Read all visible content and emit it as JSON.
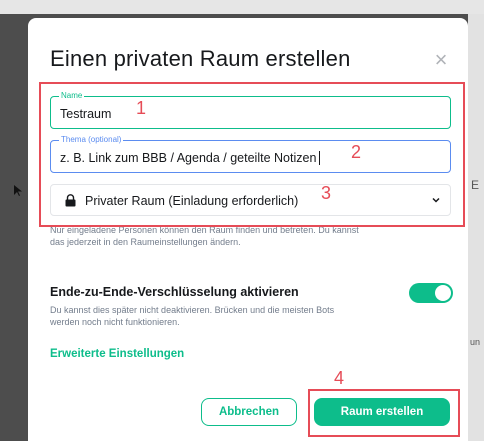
{
  "background": {
    "right_hint": "E",
    "right_hint2": "un"
  },
  "dialog": {
    "title": "Einen privaten Raum erstellen",
    "close_icon": "close-icon",
    "name_field": {
      "label": "Name",
      "value": "Testraum"
    },
    "topic_field": {
      "label": "Thema (optional)",
      "value": "z. B. Link zum BBB / Agenda / geteilte Notizen"
    },
    "visibility_select": {
      "value": "Privater Raum (Einladung erforderlich)",
      "icon": "lock-icon"
    },
    "visibility_help": "Nur eingeladene Personen können den Raum finden und betreten. Du kannst das jederzeit in den Raumeinstellungen ändern.",
    "encryption": {
      "label": "Ende-zu-Ende-Verschlüsselung aktivieren",
      "enabled": true,
      "help": "Du kannst dies später nicht deaktivieren. Brücken und die meisten Bots werden noch nicht funktionieren."
    },
    "advanced_link": "Erweiterte Einstellungen",
    "cancel_label": "Abbrechen",
    "create_label": "Raum erstellen"
  },
  "annotations": {
    "n1": "1",
    "n2": "2",
    "n3": "3",
    "n4": "4"
  },
  "colors": {
    "accent": "#0dbd8b",
    "annotation": "#e64c57",
    "focus": "#5b8cf0"
  }
}
